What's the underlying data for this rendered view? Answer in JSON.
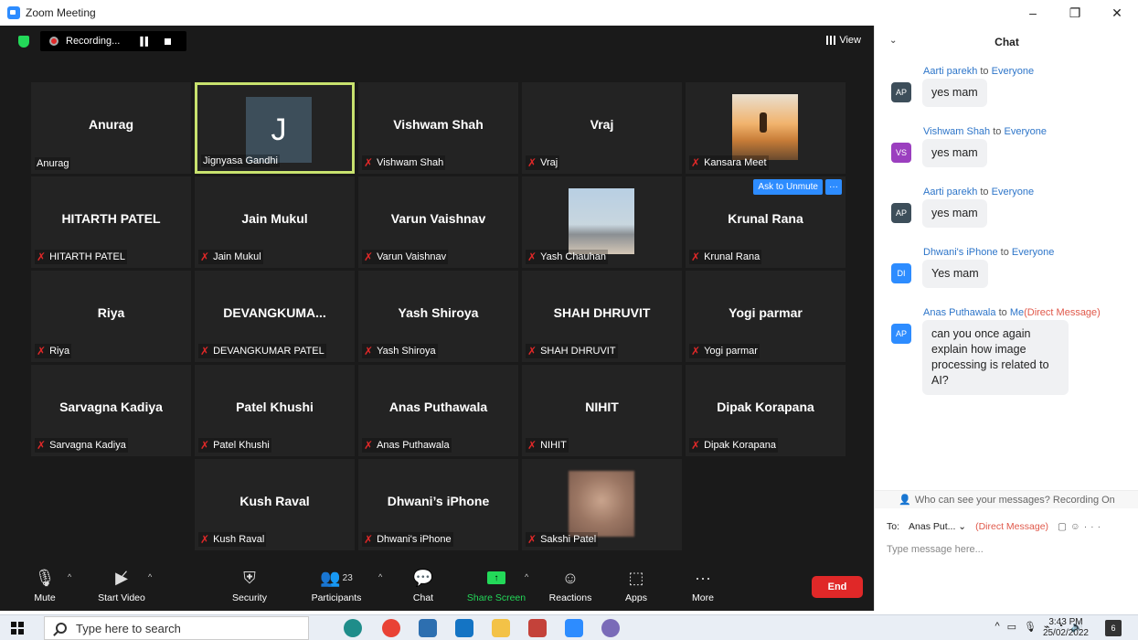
{
  "window": {
    "title": "Zoom Meeting",
    "minimize": "–",
    "restore": "❐",
    "close": "✕"
  },
  "topbar": {
    "recording_label": "Recording...",
    "view_label": "View"
  },
  "tiles": [
    {
      "display": "Anurag",
      "label": "Anurag",
      "muted": false
    },
    {
      "display": "J",
      "label": "Jignyasa Gandhi",
      "muted": false,
      "active": true
    },
    {
      "display": "Vishwam Shah",
      "label": "Vishwam Shah",
      "muted": true
    },
    {
      "display": "Vraj",
      "label": "Vraj",
      "muted": true
    },
    {
      "display": "",
      "label": "Kansara Meet",
      "muted": true
    },
    {
      "display": "HITARTH PATEL",
      "label": "HITARTH PATEL",
      "muted": true
    },
    {
      "display": "Jain Mukul",
      "label": "Jain Mukul",
      "muted": true
    },
    {
      "display": "Varun Vaishnav",
      "label": "Varun Vaishnav",
      "muted": true
    },
    {
      "display": "",
      "label": "Yash Chauhan",
      "muted": true
    },
    {
      "display": "Krunal Rana",
      "label": "Krunal Rana",
      "muted": true
    },
    {
      "display": "Riya",
      "label": "Riya",
      "muted": true
    },
    {
      "display": "DEVANGKUMA...",
      "label": "DEVANGKUMAR PATEL",
      "muted": true
    },
    {
      "display": "Yash Shiroya",
      "label": "Yash Shiroya",
      "muted": true
    },
    {
      "display": "SHAH DHRUVIT",
      "label": "SHAH DHRUVIT",
      "muted": true
    },
    {
      "display": "Yogi parmar",
      "label": "Yogi parmar",
      "muted": true
    },
    {
      "display": "Sarvagna Kadiya",
      "label": "Sarvagna Kadiya",
      "muted": true
    },
    {
      "display": "Patel Khushi",
      "label": "Patel Khushi",
      "muted": true
    },
    {
      "display": "Anas Puthawala",
      "label": "Anas Puthawala",
      "muted": true
    },
    {
      "display": "NIHIT",
      "label": "NIHIT",
      "muted": true
    },
    {
      "display": "Dipak Korapana",
      "label": "Dipak Korapana",
      "muted": true
    },
    {
      "display": "Kush Raval",
      "label": "Kush Raval",
      "muted": true
    },
    {
      "display": "Dhwani’s iPhone",
      "label": "Dhwani's iPhone",
      "muted": true
    },
    {
      "display": "",
      "label": "Sakshi Patel",
      "muted": true
    }
  ],
  "ask_to_unmute": "Ask to Unmute",
  "more_dots": "···",
  "toolbar": {
    "mute": "Mute",
    "start_video": "Start Video",
    "security": "Security",
    "participants": "Participants",
    "participants_count": "23",
    "chat": "Chat",
    "share_screen": "Share Screen",
    "reactions": "Reactions",
    "apps": "Apps",
    "more": "More",
    "end": "End"
  },
  "chat": {
    "title": "Chat",
    "messages": [
      {
        "sender": "Aarti parekh",
        "to": "to",
        "recipient": "Everyone",
        "dm": "",
        "initials": "AP",
        "color": "#3d4e5a",
        "text": "yes mam"
      },
      {
        "sender": "Vishwam Shah",
        "to": "to",
        "recipient": "Everyone",
        "dm": "",
        "initials": "VS",
        "color": "#9b3fbf",
        "text": "yes mam"
      },
      {
        "sender": "Aarti parekh",
        "to": "to",
        "recipient": "Everyone",
        "dm": "",
        "initials": "AP",
        "color": "#3d4e5a",
        "text": "yes mam"
      },
      {
        "sender": "Dhwani's iPhone",
        "to": "to",
        "recipient": "Everyone",
        "dm": "",
        "initials": "DI",
        "color": "#2d8cff",
        "text": "Yes mam"
      },
      {
        "sender": "Anas Puthawala",
        "to": "to",
        "recipient": "Me",
        "dm": "(Direct Message)",
        "initials": "AP",
        "color": "#2d8cff",
        "text": "can you once again explain how image processing is related to AI?"
      }
    ],
    "privacy_text": "Who can see your messages? Recording On",
    "to_label": "To:",
    "to_value": "Anas Put... ⌄",
    "to_dm": "(Direct Message)",
    "input_placeholder": "Type message here..."
  },
  "taskbar": {
    "search_placeholder": "Type here to search",
    "time": "3:43 PM",
    "date": "25/02/2022",
    "notification_count": "6"
  }
}
